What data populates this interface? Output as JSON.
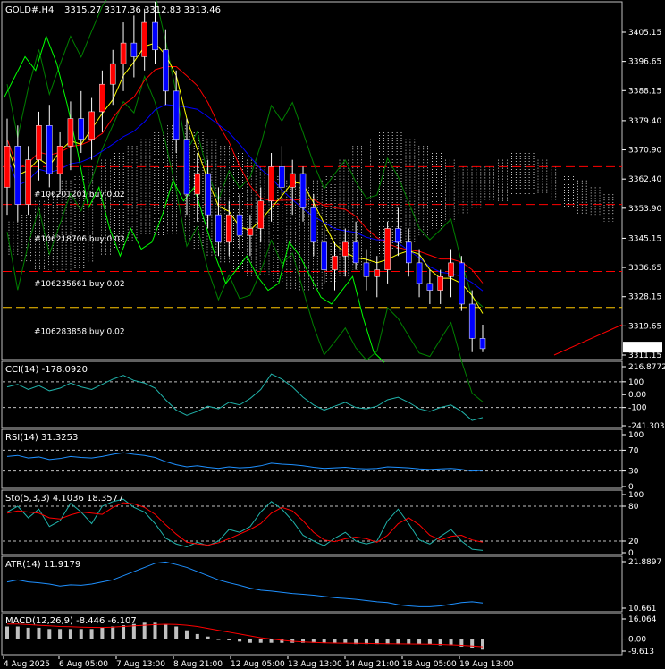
{
  "main": {
    "symbol": "GOLD#,H4",
    "ohlc": "3315.27 3317.36 3312.83 3313.46",
    "price_labels": [
      "3405.15",
      "3396.65",
      "3388.15",
      "3379.40",
      "3370.90",
      "3362.40",
      "3353.90",
      "3345.15",
      "3336.65",
      "3328.15",
      "3319.65",
      "3311.15"
    ],
    "current_price": "3313.46",
    "orders": [
      "#106201201 buy 0.02",
      "#106218706 buy 0.02",
      "#106235661 buy 0.02",
      "#106283858 buy 0.02"
    ],
    "colors": {
      "bull": "#ff0000",
      "bear": "#0000ff",
      "wick": "#ffffff",
      "cloud": "#ffffff",
      "kijun": "#ff0000",
      "tenkan": "#0000ff",
      "chikou": "#00ff00",
      "bands": "#008000",
      "ma": "#ffff00",
      "hline_red": "#ff0000",
      "hline_yellow": "#ffc800",
      "grid": "#ffffff"
    }
  },
  "cci": {
    "label": "CCI(14) -178.0920",
    "levels": [
      "216.8772",
      "100",
      "0.00",
      "-100",
      "-241.303"
    ],
    "color": "#20b2aa"
  },
  "rsi": {
    "label": "RSI(14) 31.3253",
    "levels": [
      "100",
      "70",
      "30",
      "0"
    ],
    "color": "#1e90ff"
  },
  "sto": {
    "label": "Sto(5,3,3) 4.1036 18.3577",
    "levels": [
      "100",
      "80",
      "20",
      "0"
    ],
    "colors": [
      "#20b2aa",
      "#ff0000"
    ]
  },
  "atr": {
    "label": "ATR(14) 11.9179",
    "levels": [
      "21.8897",
      "10.661"
    ],
    "color": "#1e90ff"
  },
  "macd": {
    "label": "MACD(12,26,9) -8.446 -6.107",
    "levels": [
      "16.064",
      "0.00",
      "-9.613"
    ],
    "colors": [
      "#c0c0c0",
      "#ff0000"
    ]
  },
  "time_labels": [
    "4 Aug 2025",
    "6 Aug 05:00",
    "7 Aug 13:00",
    "8 Aug 21:00",
    "12 Aug 05:00",
    "13 Aug 13:00",
    "14 Aug 21:00",
    "18 Aug 05:00",
    "19 Aug 13:00"
  ],
  "series": {
    "candles": [
      [
        3360,
        3380,
        3352,
        3372
      ],
      [
        3372,
        3378,
        3350,
        3355
      ],
      [
        3355,
        3372,
        3352,
        3368
      ],
      [
        3368,
        3382,
        3362,
        3378
      ],
      [
        3378,
        3384,
        3360,
        3364
      ],
      [
        3364,
        3376,
        3358,
        3372
      ],
      [
        3372,
        3385,
        3365,
        3380
      ],
      [
        3380,
        3388,
        3370,
        3374
      ],
      [
        3374,
        3386,
        3368,
        3382
      ],
      [
        3382,
        3394,
        3376,
        3390
      ],
      [
        3390,
        3400,
        3384,
        3396
      ],
      [
        3396,
        3408,
        3388,
        3402
      ],
      [
        3402,
        3410,
        3392,
        3398
      ],
      [
        3398,
        3412,
        3394,
        3408
      ],
      [
        3408,
        3414,
        3396,
        3400
      ],
      [
        3400,
        3406,
        3384,
        3388
      ],
      [
        3388,
        3394,
        3370,
        3374
      ],
      [
        3374,
        3380,
        3352,
        3358
      ],
      [
        3358,
        3370,
        3350,
        3364
      ],
      [
        3364,
        3368,
        3348,
        3352
      ],
      [
        3352,
        3360,
        3340,
        3344
      ],
      [
        3344,
        3356,
        3340,
        3352
      ],
      [
        3352,
        3358,
        3342,
        3346
      ],
      [
        3346,
        3352,
        3340,
        3348
      ],
      [
        3348,
        3360,
        3344,
        3356
      ],
      [
        3356,
        3370,
        3350,
        3366
      ],
      [
        3366,
        3372,
        3356,
        3360
      ],
      [
        3360,
        3368,
        3352,
        3364
      ],
      [
        3364,
        3366,
        3350,
        3354
      ],
      [
        3354,
        3358,
        3340,
        3344
      ],
      [
        3344,
        3348,
        3332,
        3336
      ],
      [
        3336,
        3344,
        3330,
        3340
      ],
      [
        3340,
        3348,
        3334,
        3344
      ],
      [
        3344,
        3350,
        3336,
        3338
      ],
      [
        3338,
        3342,
        3330,
        3334
      ],
      [
        3334,
        3340,
        3328,
        3336
      ],
      [
        3336,
        3350,
        3332,
        3348
      ],
      [
        3348,
        3354,
        3340,
        3344
      ],
      [
        3344,
        3348,
        3334,
        3338
      ],
      [
        3338,
        3342,
        3328,
        3332
      ],
      [
        3332,
        3336,
        3326,
        3330
      ],
      [
        3330,
        3336,
        3326,
        3334
      ],
      [
        3334,
        3342,
        3328,
        3338
      ],
      [
        3338,
        3340,
        3324,
        3326
      ],
      [
        3326,
        3330,
        3312,
        3316
      ],
      [
        3316,
        3320,
        3312,
        3313
      ]
    ],
    "cci": [
      60,
      80,
      40,
      70,
      30,
      50,
      90,
      60,
      40,
      80,
      120,
      150,
      110,
      90,
      50,
      -40,
      -120,
      -160,
      -130,
      -90,
      -110,
      -60,
      -80,
      -30,
      40,
      160,
      120,
      60,
      -20,
      -80,
      -120,
      -90,
      -60,
      -100,
      -110,
      -90,
      -40,
      -20,
      -60,
      -110,
      -130,
      -100,
      -80,
      -130,
      -200,
      -178
    ],
    "rsi": [
      58,
      60,
      55,
      57,
      52,
      54,
      58,
      56,
      55,
      58,
      62,
      65,
      62,
      60,
      56,
      48,
      42,
      38,
      40,
      37,
      35,
      38,
      36,
      37,
      40,
      45,
      43,
      42,
      40,
      37,
      35,
      36,
      37,
      35,
      34,
      35,
      38,
      37,
      36,
      34,
      33,
      34,
      35,
      33,
      30,
      31
    ],
    "sto_k": [
      70,
      80,
      60,
      75,
      45,
      55,
      85,
      70,
      50,
      80,
      88,
      92,
      78,
      70,
      50,
      25,
      15,
      10,
      18,
      12,
      20,
      40,
      35,
      45,
      70,
      88,
      75,
      55,
      30,
      20,
      12,
      25,
      35,
      20,
      15,
      20,
      55,
      75,
      50,
      22,
      15,
      28,
      40,
      20,
      6,
      4
    ],
    "sto_d": [
      68,
      72,
      70,
      68,
      60,
      58,
      65,
      70,
      68,
      66,
      78,
      86,
      84,
      78,
      66,
      48,
      32,
      18,
      15,
      13,
      17,
      24,
      32,
      40,
      50,
      68,
      78,
      72,
      55,
      35,
      22,
      19,
      24,
      27,
      24,
      18,
      30,
      50,
      60,
      48,
      30,
      22,
      28,
      30,
      22,
      18
    ],
    "atr": [
      17,
      17.5,
      17,
      16.8,
      16.5,
      16,
      16.3,
      16.2,
      16.5,
      17,
      17.5,
      18.5,
      19.5,
      20.5,
      21.5,
      21.8,
      21.2,
      20.5,
      19.5,
      18.5,
      17.5,
      16.8,
      16.2,
      15.5,
      15,
      14.8,
      14.5,
      14.2,
      14,
      13.8,
      13.5,
      13.2,
      13,
      12.8,
      12.5,
      12.2,
      12,
      11.5,
      11.2,
      11,
      11,
      11.2,
      11.6,
      12,
      12.2,
      11.9
    ],
    "macd_hist": [
      10,
      10,
      9,
      9,
      8,
      8,
      8,
      8,
      8,
      9,
      10,
      11,
      12,
      13,
      13,
      12,
      10,
      7,
      4,
      2,
      0,
      -1,
      -2,
      -3,
      -3,
      -3,
      -3,
      -3,
      -3,
      -3,
      -3,
      -3,
      -3,
      -4,
      -4,
      -4,
      -4,
      -4,
      -4,
      -4,
      -4,
      -5,
      -5,
      -6,
      -7,
      -8.4
    ],
    "macd_sig": [
      12,
      12,
      11.5,
      11,
      10.5,
      10,
      9.8,
      9.5,
      9.3,
      9.2,
      9.5,
      10,
      10.5,
      11,
      11.5,
      11.8,
      11.6,
      11,
      10,
      8.5,
      7,
      5.5,
      4,
      2.5,
      1,
      0,
      -1,
      -1.8,
      -2.3,
      -2.7,
      -3,
      -3.2,
      -3.3,
      -3.4,
      -3.5,
      -3.6,
      -3.7,
      -3.8,
      -3.9,
      -4,
      -4.1,
      -4.3,
      -4.6,
      -5,
      -5.5,
      -6.1
    ]
  }
}
